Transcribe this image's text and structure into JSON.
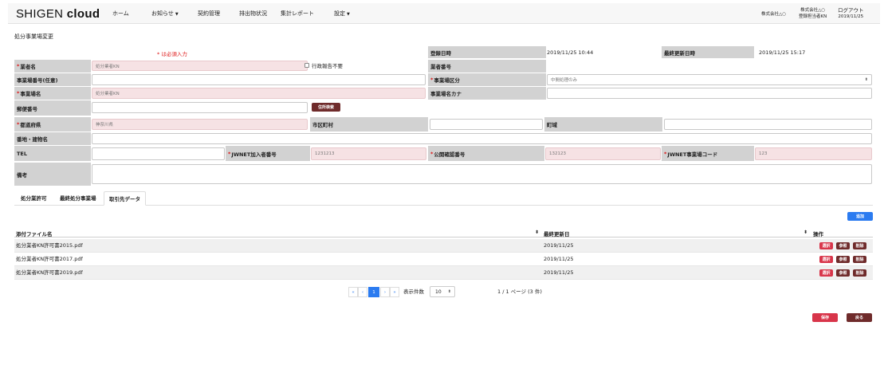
{
  "header": {
    "logo_main": "SHIGEN",
    "logo_accent": "cloud",
    "nav": [
      {
        "label": "ホーム"
      },
      {
        "label": "お知らせ"
      },
      {
        "label": "契約管理"
      },
      {
        "label": "排出物状況"
      },
      {
        "label": "集計レポート"
      },
      {
        "label": "設定"
      }
    ],
    "company_name": "株式会社△○",
    "user_company": "株式会社△○",
    "user_name": "登録担当者KN",
    "logout_label": "ログアウト",
    "date": "2019/11/25"
  },
  "page_title": "処分事業場変更",
  "form": {
    "required_note": "* は必須入力",
    "registered_at_label": "登録日時",
    "registered_at": "2019/11/25 10:44",
    "updated_at_label": "最終更新日時",
    "updated_at": "2019/11/25 15:17",
    "company_label": "業者名",
    "company_value": "処分業者KN",
    "gov_report_label": "行政報告不要",
    "company_no_label": "業者番号",
    "site_no_label": "事業場番号(任意)",
    "site_type_label": "事業場区分",
    "site_type_value": "中間処理のみ",
    "site_name_label": "事業場名",
    "site_name_value": "処分業者KN",
    "site_kana_label": "事業場名カナ",
    "postal_label": "郵便番号",
    "address_search_label": "住所検索",
    "prefecture_label": "都道府県",
    "prefecture_value": "神奈川県",
    "city_label": "市区町村",
    "town_label": "町域",
    "address_label": "番地・建物名",
    "tel_label": "TEL",
    "jwnet_member_label": "JWNET加入者番号",
    "jwnet_member_value": "1231213",
    "public_cert_label": "公開確認番号",
    "public_cert_value": "132123",
    "jwnet_site_label": "JWNET事業場コード",
    "jwnet_site_value": "123",
    "remarks_label": "備考"
  },
  "tabs": [
    {
      "label": "処分業許可"
    },
    {
      "label": "最終処分事業場"
    },
    {
      "label": "取引先データ"
    }
  ],
  "add_label": "追加",
  "table": {
    "columns": [
      "添付ファイル名",
      "最終更新日",
      "操作"
    ],
    "rows": [
      {
        "file": "処分業者KN許可書2015.pdf",
        "date": "2019/11/25"
      },
      {
        "file": "処分業者KN許可書2017.pdf",
        "date": "2019/11/25"
      },
      {
        "file": "処分業者KN許可書2019.pdf",
        "date": "2019/11/25"
      }
    ],
    "select_label": "選択",
    "view_label": "参照",
    "delete_label": "削除"
  },
  "pagination": {
    "first": "«",
    "prev": "‹",
    "current": "1",
    "next": "›",
    "last": "»",
    "per_page_label": "表示件数",
    "per_page_value": "10",
    "summary": "1 / 1 ページ (3 件)"
  },
  "save_label": "保存",
  "back_label": "戻る",
  "colors": {
    "label_bg": "#d2d2d2",
    "required_field_bg": "#f6e2e4",
    "primary_blue": "#2b7bf0",
    "danger_red": "#d8354a",
    "dark_brown": "#6f2b2b"
  }
}
